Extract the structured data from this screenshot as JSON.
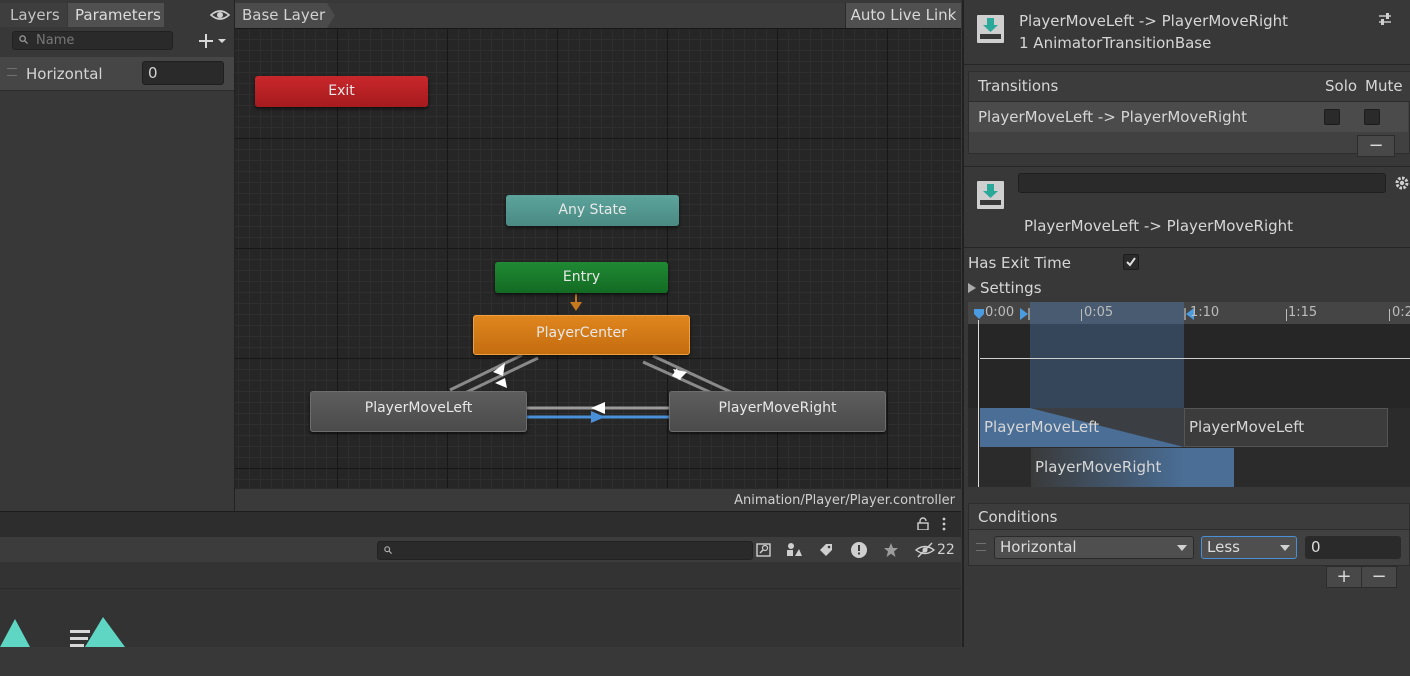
{
  "params_panel": {
    "tabs": [
      "Layers",
      "Parameters"
    ],
    "search_placeholder": "Name",
    "parameters": [
      {
        "name": "Horizontal",
        "value": "0"
      }
    ]
  },
  "graph": {
    "breadcrumb": "Base Layer",
    "auto_live_link": "Auto Live Link",
    "nodes": {
      "exit": "Exit",
      "any_state": "Any State",
      "entry": "Entry",
      "center": "PlayerCenter",
      "left": "PlayerMoveLeft",
      "right": "PlayerMoveRight"
    },
    "controller_path": "Animation/Player/Player.controller"
  },
  "project": {
    "hidden_count": "22"
  },
  "inspector": {
    "title": "PlayerMoveLeft -> PlayerMoveRight",
    "subtitle": "1 AnimatorTransitionBase",
    "transitions_header": "Transitions",
    "solo_label": "Solo",
    "mute_label": "Mute",
    "transition_row": "PlayerMoveLeft -> PlayerMoveRight",
    "remove_label": "−",
    "selected_transition": "PlayerMoveLeft -> PlayerMoveRight",
    "has_exit_time_label": "Has Exit Time",
    "has_exit_time_checked": true,
    "settings_label": "Settings",
    "timeline": {
      "ticks": [
        "0:00",
        "0:05",
        "1:10",
        "1:15",
        "0:2"
      ],
      "src_state": "PlayerMoveLeft",
      "src_state_after": "PlayerMoveLeft",
      "dst_state": "PlayerMoveRight"
    },
    "conditions_header": "Conditions",
    "condition": {
      "parameter": "Horizontal",
      "mode": "Less",
      "threshold": "0"
    },
    "add_label": "+",
    "minus_label": "−"
  },
  "colors": {
    "exit": "#c9272b",
    "any_state": "#5ca49c",
    "entry": "#1f8a34",
    "center": "#e0861e",
    "default": "#555555",
    "selected_transition": "#4a90d9"
  }
}
